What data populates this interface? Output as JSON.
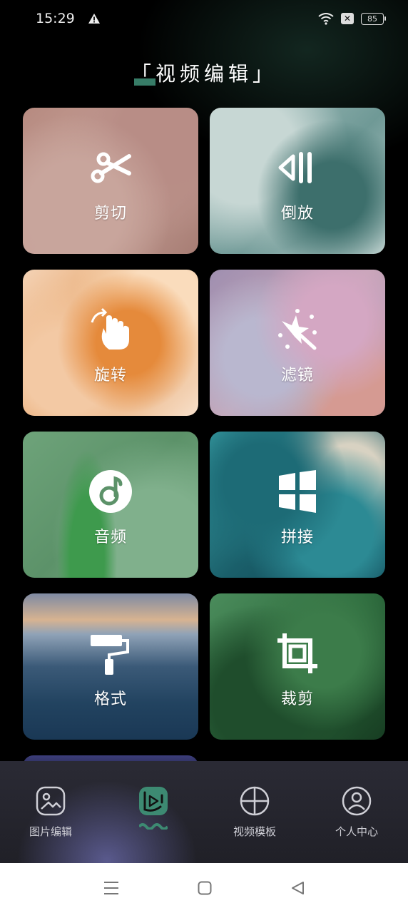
{
  "status_bar": {
    "time": "15:29",
    "battery": "85"
  },
  "header": {
    "title": "视频编辑"
  },
  "tools": [
    {
      "label": "剪切",
      "icon": "scissors-icon"
    },
    {
      "label": "倒放",
      "icon": "rewind-icon"
    },
    {
      "label": "旋转",
      "icon": "rotate-hand-icon"
    },
    {
      "label": "滤镜",
      "icon": "magic-wand-icon"
    },
    {
      "label": "音频",
      "icon": "music-note-icon"
    },
    {
      "label": "拼接",
      "icon": "windows-grid-icon"
    },
    {
      "label": "格式",
      "icon": "paint-roller-icon"
    },
    {
      "label": "裁剪",
      "icon": "crop-icon"
    }
  ],
  "tabs": [
    {
      "label": "图片编辑",
      "icon": "image-icon"
    },
    {
      "label": "",
      "icon": "video-play-icon",
      "active": true
    },
    {
      "label": "视频模板",
      "icon": "template-icon"
    },
    {
      "label": "个人中心",
      "icon": "user-icon"
    }
  ],
  "colors": {
    "accent": "#3d8a72",
    "background": "#000000"
  }
}
